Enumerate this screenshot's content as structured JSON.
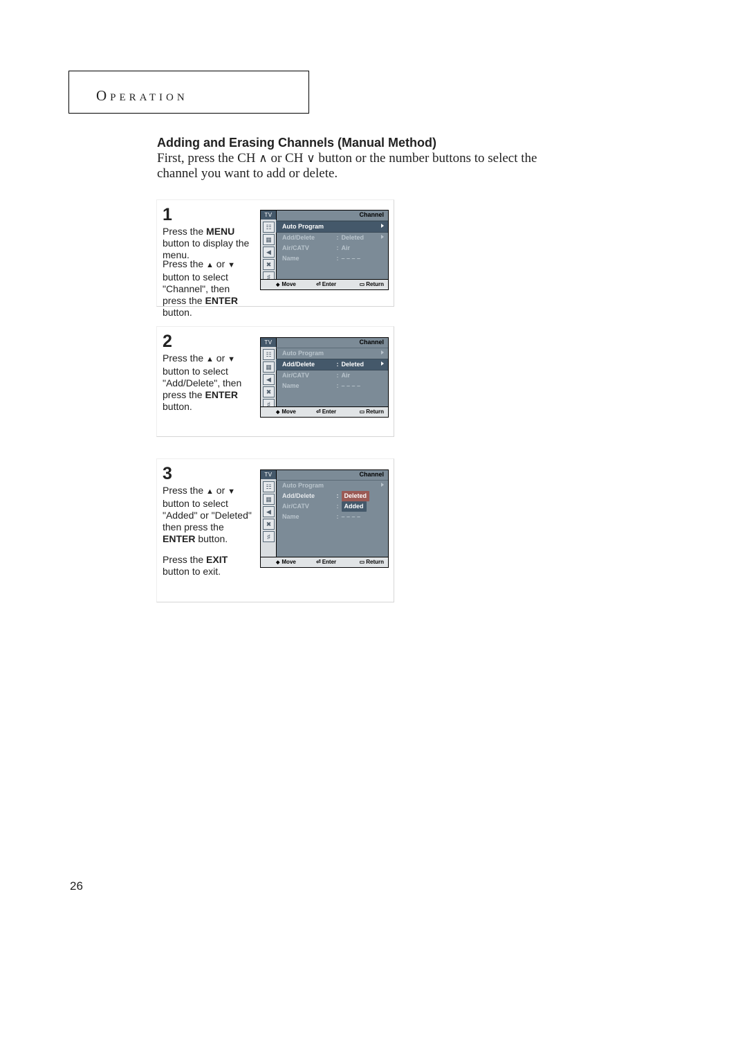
{
  "section_label": "Operation",
  "heading": "Adding and Erasing Channels (Manual Method)",
  "intro_pre": "First, press the CH ",
  "intro_mid": " or CH ",
  "intro_post": " button or the number buttons to select the channel you want to add or delete.",
  "page_number": "26",
  "steps": [
    {
      "num": "1",
      "text_a": "Press the ",
      "text_a_bold": "MENU",
      "text_a_after": " button to display the menu.",
      "gap": true,
      "text_b_pre": "Press the ",
      "text_b_mid": " or ",
      "text_b_after": " button to select \"Channel\", then press the ",
      "text_b_bold": "ENTER",
      "text_b_tail": " button."
    },
    {
      "num": "2",
      "text_b_pre": "Press the ",
      "text_b_mid": " or ",
      "text_b_after": " button to select \"Add/Delete\", then press the ",
      "text_b_bold": "ENTER",
      "text_b_tail": " button."
    },
    {
      "num": "3",
      "text_b_pre": "Press the ",
      "text_b_mid": " or ",
      "text_b_after": " button to select \"Added\" or \"Deleted\" then press the ",
      "text_b_bold": "ENTER",
      "text_b_tail": " button.",
      "gap": true,
      "exit_pre": "Press the ",
      "exit_bold": "EXIT",
      "exit_tail": " button to exit."
    }
  ],
  "osd_common": {
    "tv": "TV",
    "title": "Channel",
    "rows": {
      "auto": "Auto Program",
      "add": "Add/Delete",
      "air": "Air/CATV",
      "name": "Name",
      "val_deleted": "Deleted",
      "val_added": "Added",
      "val_air": "Air",
      "val_dashes": "– – – –"
    },
    "footer": {
      "move": "Move",
      "enter": "Enter",
      "return": "Return"
    }
  }
}
